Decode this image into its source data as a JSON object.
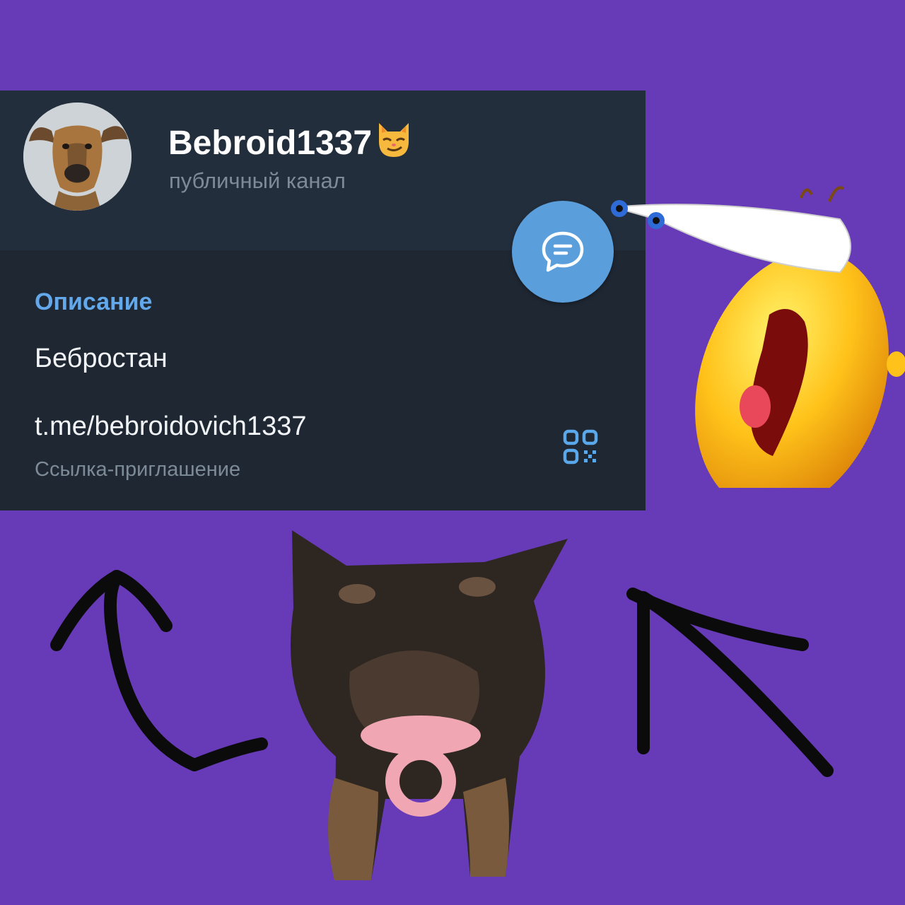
{
  "channel": {
    "name": "Bebroid1337",
    "emoji_icon": "smirking-cat-emoji",
    "type_label": "публичный канал",
    "avatar": "dog-avatar"
  },
  "info": {
    "description_title": "Описание",
    "description": "Бебростан",
    "link": "t.me/bebroidovich1337",
    "link_caption": "Ссылка-приглашение"
  },
  "icons": {
    "message_button": "message-bubble-icon",
    "qr": "qr-code-icon"
  },
  "stickers": {
    "crying_emoji": "crying-laughing-emoji-sticker",
    "dog_pacifier": "dog-with-pacifier-sticker",
    "arrows": "hand-drawn-arrows"
  },
  "colors": {
    "background": "#673ab7",
    "card": "#1f2733",
    "header": "#232e3c",
    "accent": "#62a8ea",
    "fab": "#5a9fdc"
  }
}
